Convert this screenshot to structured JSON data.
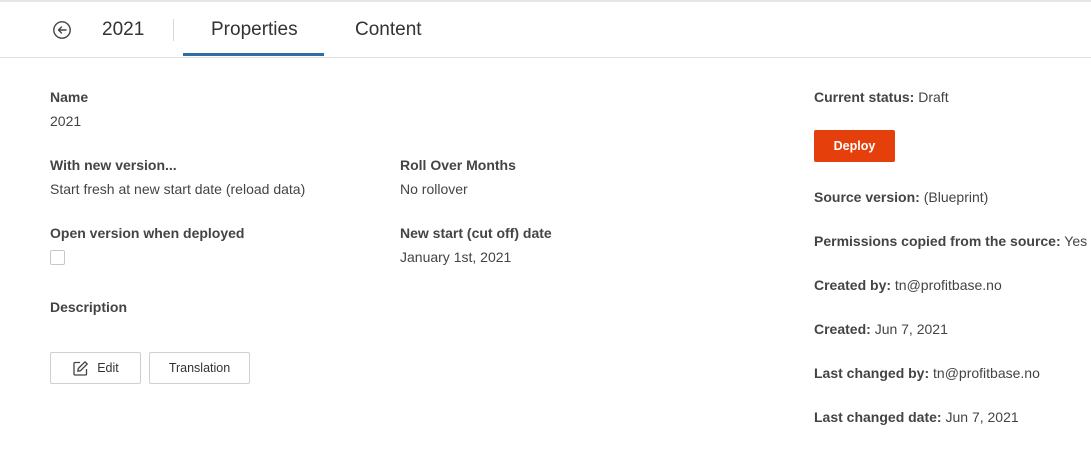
{
  "header": {
    "title": "2021",
    "tabs": [
      {
        "label": "Properties",
        "active": true
      },
      {
        "label": "Content",
        "active": false
      }
    ],
    "accent_color": "#2d6ea6"
  },
  "fields": {
    "name_label": "Name",
    "name_value": "2021",
    "new_version_label": "With new version...",
    "new_version_value": "Start fresh at new start date (reload data)",
    "rollover_label": "Roll Over Months",
    "rollover_value": "No rollover",
    "open_version_label": "Open version when deployed",
    "open_version_checked": false,
    "new_start_label": "New start (cut off) date",
    "new_start_value": "January 1st, 2021",
    "description_label": "Description"
  },
  "actions": {
    "edit_label": "Edit",
    "translation_label": "Translation",
    "deploy_label": "Deploy",
    "deploy_color": "#e5400b"
  },
  "status": {
    "current_status_label": "Current status:",
    "current_status_value": "Draft",
    "source_version_label": "Source version:",
    "source_version_value": "(Blueprint)",
    "permissions_label": "Permissions copied from the source:",
    "permissions_value": "Yes",
    "created_by_label": "Created by:",
    "created_by_value": "tn@profitbase.no",
    "created_label": "Created:",
    "created_value": "Jun 7, 2021",
    "last_changed_by_label": "Last changed by:",
    "last_changed_by_value": "tn@profitbase.no",
    "last_changed_date_label": "Last changed date:",
    "last_changed_date_value": "Jun 7, 2021"
  }
}
